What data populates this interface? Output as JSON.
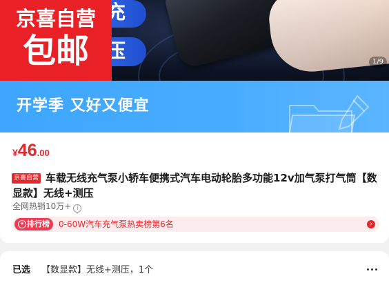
{
  "badge": {
    "line1": "京喜自营",
    "line2": "包邮"
  },
  "hero": {
    "tag_top": "充",
    "tag_bottom": "压",
    "image_counter": "1/9"
  },
  "promo": {
    "text": "开学季 又好又便宜"
  },
  "product": {
    "price_symbol": "¥",
    "price_integer": "46",
    "price_decimal": ".00",
    "self_operated_tag": "京喜自营",
    "title": "车载无线充气泵小轿车便携式汽车电动轮胎多功能12v加气泵打气筒【数显款】无线+测压",
    "sales": "全网热销10万+",
    "info_icon": "i"
  },
  "ranking": {
    "tag_label": "排行榜",
    "text": "0-60W汽车充气泵热卖榜第6名",
    "arrow_icon": "›"
  },
  "selection": {
    "label": "已选",
    "value": "【数显款】无线+测压，1个"
  },
  "colors": {
    "brand_red": "#e92127",
    "price_red": "#e4292e",
    "promo_blue": "#49adff",
    "rank_bg": "#fdecee"
  }
}
